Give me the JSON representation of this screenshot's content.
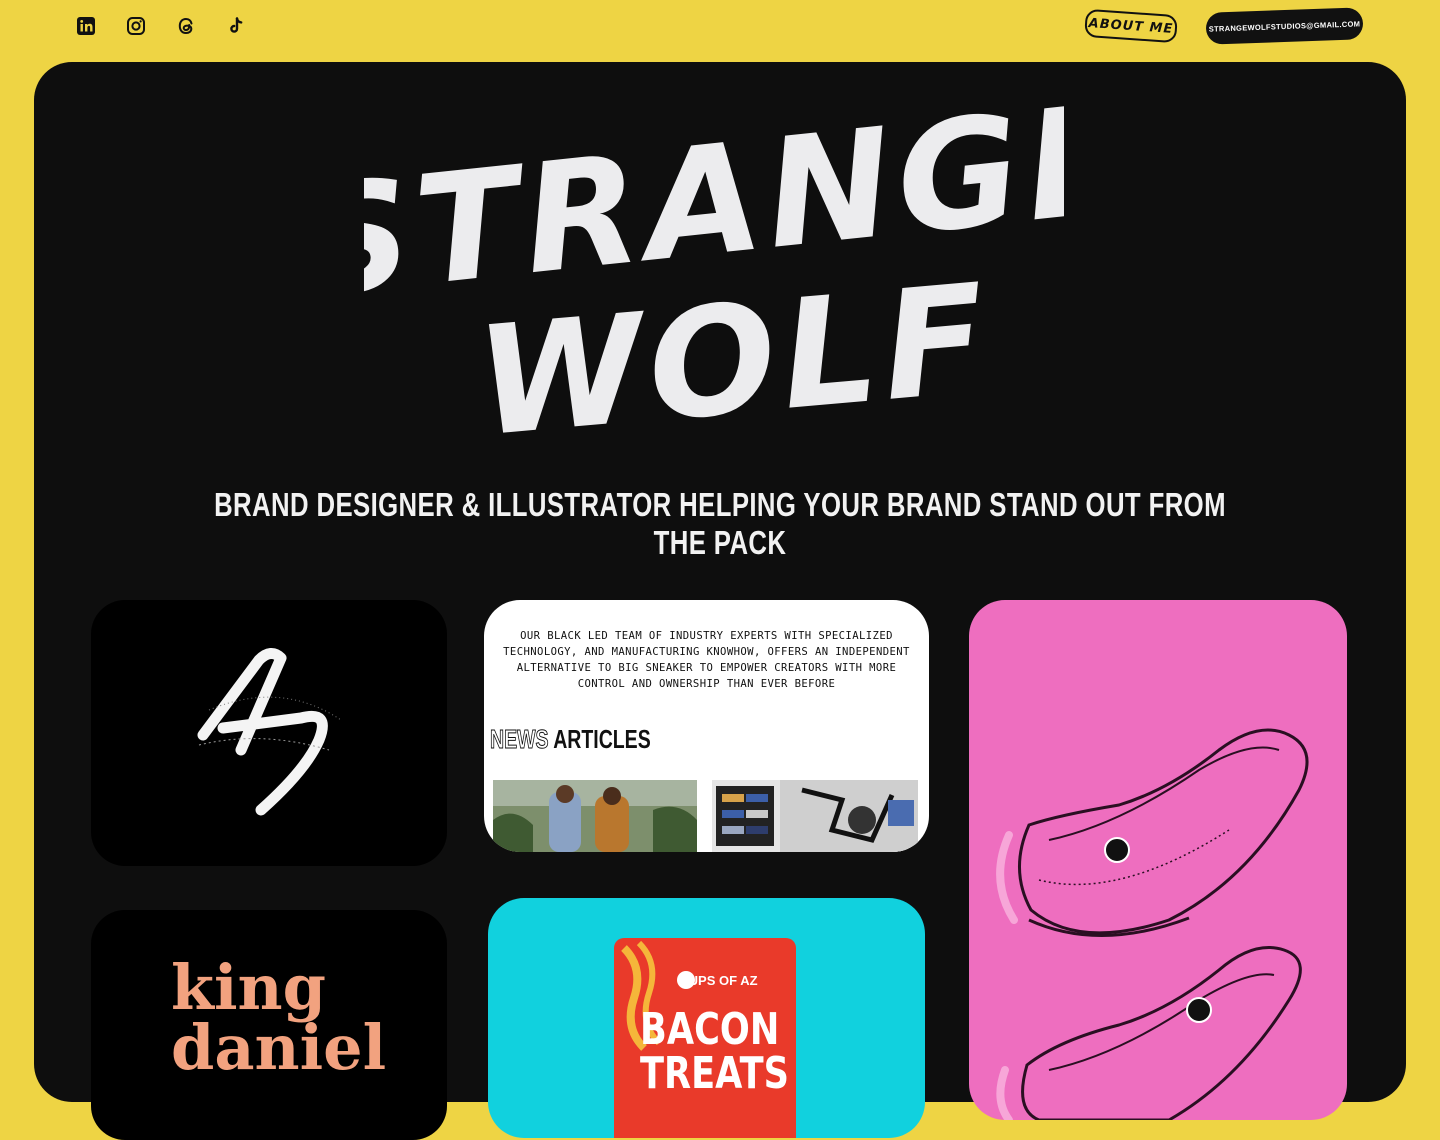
{
  "social": {
    "icons": [
      "linkedin-icon",
      "instagram-icon",
      "threads-icon",
      "tiktok-icon"
    ]
  },
  "header": {
    "about_label": "ABOUT ME",
    "email_label": "STRANGEWOLFSTUDIOS@GMAIL.COM"
  },
  "hero": {
    "logo_line1": "STRANGE",
    "logo_line2": "WOLF",
    "tagline": "BRAND DESIGNER & ILLUSTRATOR HELPING YOUR BRAND STAND OUT FROM THE PACK"
  },
  "projects": {
    "sneaker": {
      "text": "OUR BLACK LED TEAM OF INDUSTRY EXPERTS WITH SPECIALIZED TECHNOLOGY, AND MANUFACTURING KNOWHOW, OFFERS AN INDEPENDENT ALTERNATIVE TO BIG SNEAKER TO EMPOWER CREATORS WITH MORE CONTROL AND OWNERSHIP THAN EVER BEFORE",
      "news_outline": "NEWS",
      "news_solid": "ARTICLES"
    },
    "king": {
      "line1": "king",
      "line2": "daniel"
    },
    "bacon": {
      "brand": "PUPS OF AZ",
      "title": "BACON TREATS"
    }
  },
  "colors": {
    "background": "#eed444",
    "panel": "#0e0e0e",
    "pink": "#ee6ebf",
    "cyan": "#11d1de",
    "peach": "#f2a27f"
  }
}
